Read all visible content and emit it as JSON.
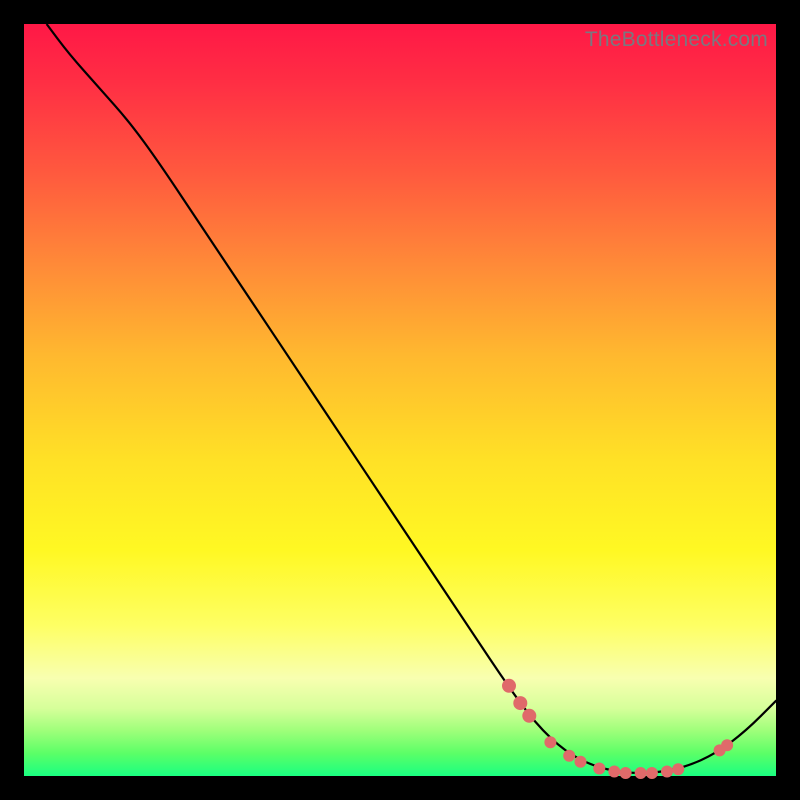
{
  "watermark": "TheBottleneck.com",
  "colors": {
    "curve_stroke": "#000000",
    "marker_fill": "#e06a6a",
    "marker_stroke": "#b94a4a"
  },
  "chart_data": {
    "type": "line",
    "title": "",
    "xlabel": "",
    "ylabel": "",
    "xlim": [
      0,
      100
    ],
    "ylim": [
      0,
      100
    ],
    "curve": [
      {
        "x": 3,
        "y": 100
      },
      {
        "x": 6,
        "y": 96
      },
      {
        "x": 10,
        "y": 91.5
      },
      {
        "x": 14,
        "y": 87
      },
      {
        "x": 18,
        "y": 81.5
      },
      {
        "x": 24,
        "y": 72.5
      },
      {
        "x": 30,
        "y": 63.5
      },
      {
        "x": 36,
        "y": 54.5
      },
      {
        "x": 42,
        "y": 45.5
      },
      {
        "x": 48,
        "y": 36.5
      },
      {
        "x": 54,
        "y": 27.5
      },
      {
        "x": 60,
        "y": 18.5
      },
      {
        "x": 64,
        "y": 12.5
      },
      {
        "x": 68,
        "y": 7.0
      },
      {
        "x": 72,
        "y": 3.2
      },
      {
        "x": 76,
        "y": 1.2
      },
      {
        "x": 80,
        "y": 0.4
      },
      {
        "x": 84,
        "y": 0.4
      },
      {
        "x": 88,
        "y": 1.2
      },
      {
        "x": 92,
        "y": 3.0
      },
      {
        "x": 96,
        "y": 6.0
      },
      {
        "x": 100,
        "y": 10.0
      }
    ],
    "markers": [
      {
        "x": 64.5,
        "y": 12.0,
        "r": 7
      },
      {
        "x": 66.0,
        "y": 9.7,
        "r": 7
      },
      {
        "x": 67.2,
        "y": 8.0,
        "r": 7
      },
      {
        "x": 70.0,
        "y": 4.5,
        "r": 6
      },
      {
        "x": 72.5,
        "y": 2.7,
        "r": 6
      },
      {
        "x": 74.0,
        "y": 1.9,
        "r": 6
      },
      {
        "x": 76.5,
        "y": 1.0,
        "r": 6
      },
      {
        "x": 78.5,
        "y": 0.6,
        "r": 6
      },
      {
        "x": 80.0,
        "y": 0.4,
        "r": 6
      },
      {
        "x": 82.0,
        "y": 0.4,
        "r": 6
      },
      {
        "x": 83.5,
        "y": 0.4,
        "r": 6
      },
      {
        "x": 85.5,
        "y": 0.6,
        "r": 6
      },
      {
        "x": 87.0,
        "y": 0.9,
        "r": 6
      },
      {
        "x": 92.5,
        "y": 3.4,
        "r": 6
      },
      {
        "x": 93.5,
        "y": 4.1,
        "r": 6
      }
    ]
  }
}
